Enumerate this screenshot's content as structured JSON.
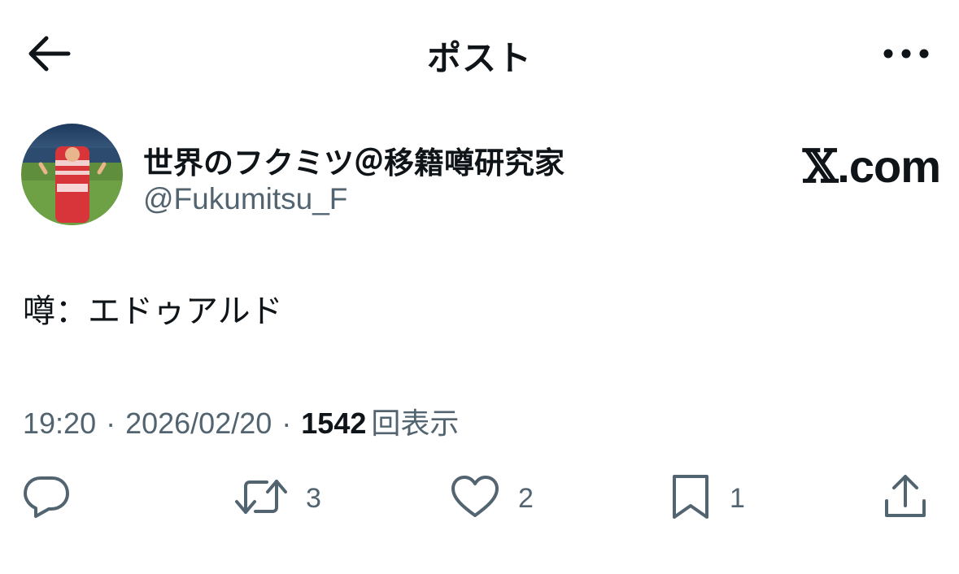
{
  "header": {
    "title": "ポスト",
    "back_icon": "arrow-left-icon",
    "more_icon": "ellipsis-horizontal-icon"
  },
  "author": {
    "display_name": "世界のフクミツ＠移籍噂研究家",
    "handle": "@Fukumitsu_F"
  },
  "brand": {
    "x_glyph": "𝕏",
    "suffix": ".com"
  },
  "tweet": {
    "text": "噂：エドゥアルド",
    "time": "19:20",
    "date": "2026/02/20",
    "separator": "·",
    "views_count": "1542",
    "views_label": "回表示"
  },
  "actions": {
    "reply": {
      "icon": "reply-icon",
      "count": ""
    },
    "repost": {
      "icon": "repost-icon",
      "count": "3"
    },
    "like": {
      "icon": "heart-icon",
      "count": "2"
    },
    "bookmark": {
      "icon": "bookmark-icon",
      "count": "1"
    },
    "share": {
      "icon": "share-icon"
    }
  },
  "colors": {
    "text_primary": "#0f1419",
    "text_secondary": "#536471",
    "background": "#ffffff"
  }
}
